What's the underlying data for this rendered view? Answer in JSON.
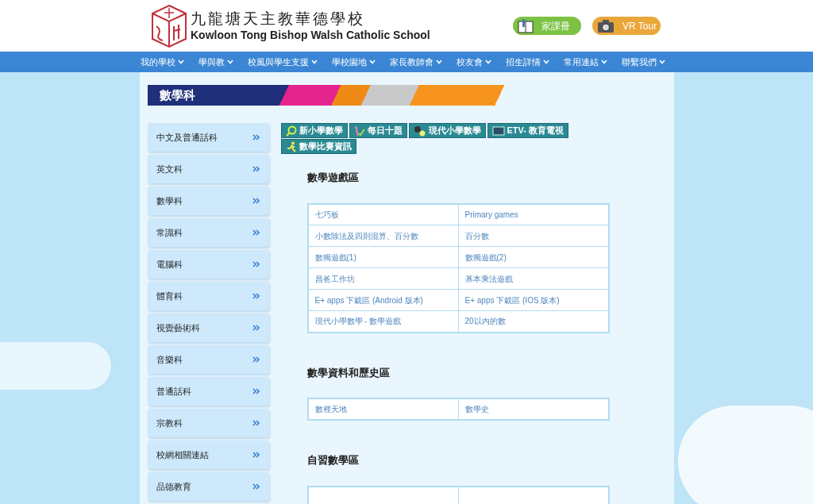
{
  "header": {
    "school_name_zh": "九龍塘天主教華德學校",
    "school_name_en": "Kowloon Tong Bishop Walsh Catholic School",
    "buttons": [
      {
        "kind": "homework",
        "label": "家課冊"
      },
      {
        "kind": "vr",
        "label": "VR Tour"
      }
    ]
  },
  "nav": [
    "我的學校",
    "學與教",
    "校風與學生支援",
    "學校園地",
    "家長教師會",
    "校友會",
    "招生詳情",
    "常用連結",
    "聯繫我們"
  ],
  "page_title": "數學科",
  "sidebar": [
    "中文及普通話科",
    "英文科",
    "數學科",
    "常識科",
    "電腦科",
    "體育科",
    "視覺藝術科",
    "音樂科",
    "普通話科",
    "宗教科",
    "校網相關連結",
    "品德教育"
  ],
  "link_tabs": [
    {
      "kind": "search",
      "label": "新小學數學"
    },
    {
      "kind": "pencil",
      "label": "每日十題"
    },
    {
      "kind": "gears",
      "label": "現代小學數學"
    },
    {
      "kind": "tv",
      "label": "ETV- 教育電視"
    },
    {
      "kind": "runner",
      "label": "數學比賽資訊"
    }
  ],
  "sections": [
    {
      "title": "數學遊戲區",
      "rows": [
        [
          "七巧板",
          "Primary games"
        ],
        [
          "小數除法及四則混算、百分數",
          "百分數"
        ],
        [
          "數獨遊戲(1)",
          "數獨遊戲(2)"
        ],
        [
          "昌爸工作坊",
          "基本乘法遊戲"
        ],
        [
          "E+ apps 下載區 (Android 版本)",
          "E+ apps 下載區 (IOS 版本)"
        ],
        [
          "現代小學數學 - 數學遊戲",
          "20以內的數"
        ]
      ]
    },
    {
      "title": "數學資料和歷史區",
      "rows": [
        [
          "數裡天地",
          "數學史"
        ]
      ]
    },
    {
      "title": "自習數學區"
    }
  ]
}
